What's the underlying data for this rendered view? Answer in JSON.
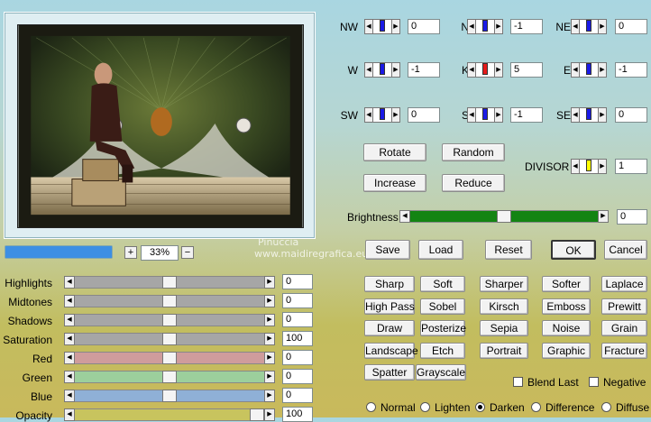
{
  "colors": {
    "track_gray": "#a6a6a6",
    "track_red": "#cf9c9c",
    "track_green": "#9ccf9c",
    "track_blue": "#8fb0d6",
    "track_opacity": "#c8c45e",
    "brightness_track": "#138413",
    "thumb_blue": "#1a1ae6",
    "thumb_red": "#e61a1a",
    "thumb_yellow": "#ffff00",
    "progress_blue": "#3d8fe4"
  },
  "preview": {
    "progress": 1.0
  },
  "zoom": {
    "plus": "+",
    "value": "33%",
    "minus": "−"
  },
  "watermark": {
    "line1": "Pinuccia",
    "line2": "www.maidiregrafica.eu"
  },
  "matrix": [
    {
      "label": "NW",
      "value": "0",
      "thumb": "blue"
    },
    {
      "label": "N",
      "value": "-1",
      "thumb": "blue"
    },
    {
      "label": "NE",
      "value": "0",
      "thumb": "blue"
    },
    {
      "label": "W",
      "value": "-1",
      "thumb": "blue"
    },
    {
      "label": "K",
      "value": "5",
      "thumb": "red"
    },
    {
      "label": "E",
      "value": "-1",
      "thumb": "blue"
    },
    {
      "label": "SW",
      "value": "0",
      "thumb": "blue"
    },
    {
      "label": "S",
      "value": "-1",
      "thumb": "blue"
    },
    {
      "label": "SE",
      "value": "0",
      "thumb": "blue"
    }
  ],
  "buttons": {
    "rotate": "Rotate",
    "random": "Random",
    "increase": "Increase",
    "reduce": "Reduce",
    "save": "Save",
    "load": "Load",
    "reset": "Reset",
    "ok": "OK",
    "cancel": "Cancel"
  },
  "divisor": {
    "label": "DIVISOR",
    "value": "1"
  },
  "brightness": {
    "label": "Brightness",
    "value": "0",
    "level": 0.5
  },
  "adjust": [
    {
      "label": "Highlights",
      "value": "0",
      "level": 0.5,
      "color": "gray"
    },
    {
      "label": "Midtones",
      "value": "0",
      "level": 0.5,
      "color": "gray"
    },
    {
      "label": "Shadows",
      "value": "0",
      "level": 0.5,
      "color": "gray"
    },
    {
      "label": "Saturation",
      "value": "100",
      "level": 0.5,
      "color": "gray"
    },
    {
      "label": "Red",
      "value": "0",
      "level": 0.5,
      "color": "red"
    },
    {
      "label": "Green",
      "value": "0",
      "level": 0.5,
      "color": "green"
    },
    {
      "label": "Blue",
      "value": "0",
      "level": 0.5,
      "color": "blue"
    },
    {
      "label": "Opacity",
      "value": "100",
      "level": 1.0,
      "color": "opacity"
    }
  ],
  "presets": [
    [
      "Sharp",
      "Soft",
      "Sharper",
      "Softer",
      "Laplace"
    ],
    [
      "High Pass",
      "Sobel",
      "Kirsch",
      "Emboss",
      "Prewitt"
    ],
    [
      "Draw",
      "Posterize",
      "Sepia",
      "Noise",
      "Grain"
    ],
    [
      "Landscape",
      "Etch",
      "Portrait",
      "Graphic",
      "Fracture"
    ],
    [
      "Spatter",
      "Grayscale"
    ]
  ],
  "options": {
    "blend_last": "Blend Last",
    "negative": "Negative"
  },
  "blend_modes": [
    {
      "label": "Normal",
      "selected": false
    },
    {
      "label": "Lighten",
      "selected": false
    },
    {
      "label": "Darken",
      "selected": true
    },
    {
      "label": "Difference",
      "selected": false
    },
    {
      "label": "Diffuse",
      "selected": false
    }
  ]
}
